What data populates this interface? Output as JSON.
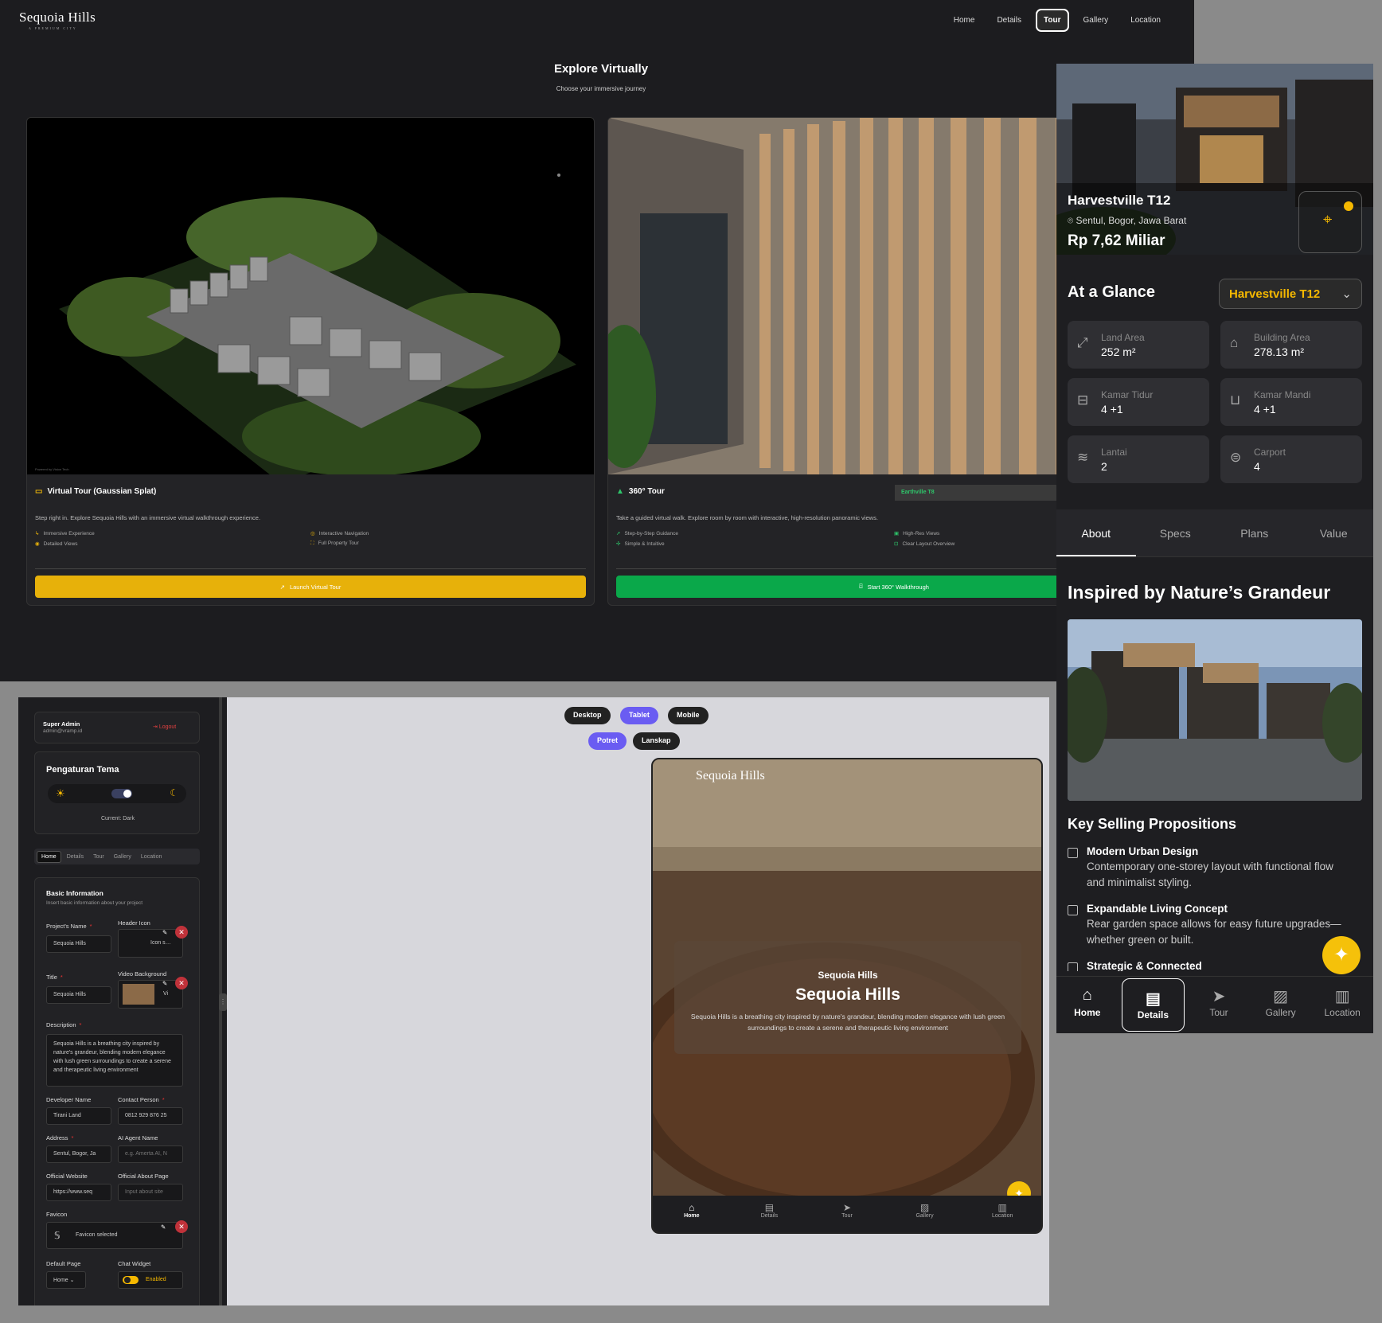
{
  "desktop": {
    "logo": "Sequoia Hills",
    "logo_tag": "A PREMIUM CITY",
    "nav": [
      "Home",
      "Details",
      "Tour",
      "Gallery",
      "Location"
    ],
    "active_nav": "Tour",
    "title": "Explore Virtually",
    "subtitle": "Choose your immersive journey",
    "card1": {
      "title": "Virtual Tour (Gaussian Splat)",
      "desc": "Step right in. Explore Sequoia Hills with an immersive virtual walkthrough experience.",
      "features": [
        "Immersive Experience",
        "Interactive Navigation",
        "Detailed Views",
        "Full Property Tour"
      ],
      "button": "Launch Virtual Tour",
      "credit": "Powered by Vision Tech"
    },
    "card2": {
      "title": "360° Tour",
      "tag": "Earthville T8",
      "desc": "Take a guided virtual walk. Explore room by room with interactive, high-resolution panoramic views.",
      "features": [
        "Step-by-Step Guidance",
        "High-Res Views",
        "Simple & Intuitive",
        "Clear Layout Overview"
      ],
      "button": "Start 360° Walkthrough"
    }
  },
  "mobile": {
    "name": "Harvestville T12",
    "location": "Sentul, Bogor, Jawa Barat",
    "price": "Rp 7,62 Miliar",
    "glance_title": "At a Glance",
    "selected_unit": "Harvestville T12",
    "stats": [
      {
        "label": "Land Area",
        "value": "252 m²",
        "icon": "expand-icon"
      },
      {
        "label": "Building Area",
        "value": "278.13 m²",
        "icon": "house-icon"
      },
      {
        "label": "Kamar Tidur",
        "value": "4 +1",
        "icon": "bed-icon"
      },
      {
        "label": "Kamar Mandi",
        "value": "4 +1",
        "icon": "bath-icon"
      },
      {
        "label": "Lantai",
        "value": "2",
        "icon": "layers-icon"
      },
      {
        "label": "Carport",
        "value": "4",
        "icon": "car-icon"
      }
    ],
    "tabs": [
      "About",
      "Specs",
      "Plans",
      "Value"
    ],
    "active_tab": "About",
    "section_title": "Inspired by Nature’s Grandeur",
    "ksp_title": "Key Selling Propositions",
    "ksp": [
      {
        "title": "Modern Urban Design",
        "desc": "Contemporary one-storey layout with functional flow and minimalist styling."
      },
      {
        "title": "Expandable Living Concept",
        "desc": "Rear garden space allows for easy future upgrades—whether green or built."
      },
      {
        "title": "Strategic & Connected",
        "desc": ""
      }
    ],
    "bottom_nav": [
      "Home",
      "Details",
      "Tour",
      "Gallery",
      "Location"
    ],
    "active_bottom": "Details"
  },
  "admin": {
    "user_name": "Super Admin",
    "user_email": "admin@vramp.id",
    "logout": "Logout",
    "theme_title": "Pengaturan Tema",
    "theme_current": "Current: Dark",
    "page_tabs": [
      "Home",
      "Details",
      "Tour",
      "Gallery",
      "Location"
    ],
    "active_page_tab": "Home",
    "section_title": "Basic Information",
    "section_sub": "Insert basic information about your project",
    "fields": {
      "project_name_label": "Project's Name",
      "project_name": "Sequoia Hills",
      "header_icon_label": "Header Icon",
      "header_icon_value": "Icon s…",
      "title_label": "Title",
      "title_value": "Sequoia Hills",
      "video_label": "Video Background",
      "video_value": "Vi",
      "description_label": "Description",
      "description": "Sequoia Hills is a breathing city inspired by nature's grandeur, blending modern elegance with lush green surroundings to create a serene and therapeutic living environment",
      "developer_label": "Developer Name",
      "developer": "Tirani Land",
      "contact_label": "Contact Person",
      "contact": "0812 929 876 25",
      "address_label": "Address",
      "address": "Sentul, Bogor, Ja",
      "ai_label": "AI Agent Name",
      "ai_placeholder": "e.g. Amerta AI, N",
      "website_label": "Official Website",
      "website": "https://www.seq",
      "about_label": "Official About Page",
      "about_placeholder": "Input about site",
      "favicon_label": "Favicon",
      "favicon_value": "Favicon selected",
      "default_page_label": "Default Page",
      "default_page": "Home",
      "chat_label": "Chat Widget",
      "chat_value": "Enabled"
    },
    "devices": [
      "Desktop",
      "Tablet",
      "Mobile"
    ],
    "active_device": "Tablet",
    "orientations": [
      "Potret",
      "Lanskap"
    ],
    "active_orientation": "Potret",
    "preview": {
      "logo": "Sequoia Hills",
      "subtitle": "Sequoia Hills",
      "title": "Sequoia Hills",
      "desc": "Sequoia Hills is a breathing city inspired by nature's grandeur, blending modern elegance with lush green surroundings to create a serene and therapeutic living environment",
      "nav": [
        "Home",
        "Details",
        "Tour",
        "Gallery",
        "Location"
      ]
    }
  },
  "colors": {
    "accent_yellow": "#e7b10a",
    "accent_green": "#0aa84a",
    "accent_purple": "#6a5cf2",
    "danger": "#c0323a"
  }
}
